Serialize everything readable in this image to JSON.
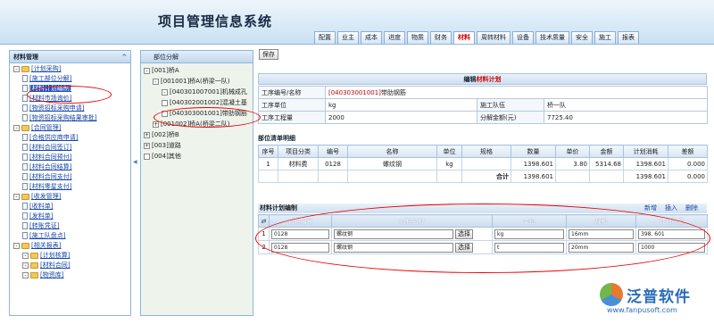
{
  "app": {
    "title": "项目管理信息系统"
  },
  "tabs": [
    "配置",
    "业主",
    "成本",
    "进度",
    "物质",
    "财务",
    "材料",
    "周转材料",
    "设备",
    "技术质量",
    "安全",
    "施工",
    "报表"
  ],
  "active_tab": "材料",
  "left_panel": {
    "title": "材料管理",
    "items": [
      {
        "type": "group",
        "label": "[计划采购]",
        "level": 0
      },
      {
        "type": "leaf",
        "label": "[施工部位分解]",
        "level": 1
      },
      {
        "type": "leaf",
        "label": "[材料计划编制]",
        "level": 1,
        "selected": true
      },
      {
        "type": "leaf",
        "label": "[材料市场询价]",
        "level": 1
      },
      {
        "type": "leaf",
        "label": "[物资招标采购申请]",
        "level": 1
      },
      {
        "type": "leaf",
        "label": "[物资招标采购结果审批]",
        "level": 1
      },
      {
        "type": "group",
        "label": "[合同管理]",
        "level": 0
      },
      {
        "type": "leaf",
        "label": "[合格供应商申请]",
        "level": 1
      },
      {
        "type": "leaf",
        "label": "[材料合同签订]",
        "level": 1
      },
      {
        "type": "leaf",
        "label": "[材料合同预付]",
        "level": 1
      },
      {
        "type": "leaf",
        "label": "[材料合同结算]",
        "level": 1
      },
      {
        "type": "leaf",
        "label": "[材料合同支付]",
        "level": 1
      },
      {
        "type": "leaf",
        "label": "[材料零星支付]",
        "level": 1
      },
      {
        "type": "group",
        "label": "[收发管理]",
        "level": 0
      },
      {
        "type": "leaf",
        "label": "[收料单]",
        "level": 1
      },
      {
        "type": "leaf",
        "label": "[发料单]",
        "level": 1
      },
      {
        "type": "leaf",
        "label": "[转账凭证]",
        "level": 1
      },
      {
        "type": "leaf",
        "label": "[施工队盘点]",
        "level": 1
      },
      {
        "type": "group",
        "label": "[相关报表]",
        "level": 0
      },
      {
        "type": "group",
        "label": "[计划核算]",
        "level": 1
      },
      {
        "type": "group",
        "label": "[材料合同]",
        "level": 1
      },
      {
        "type": "group",
        "label": "[物资库]",
        "level": 1
      }
    ]
  },
  "mid_panel": {
    "title": "部位分解",
    "items": [
      {
        "sign": "-",
        "label": "[001]桥A",
        "level": 0
      },
      {
        "sign": "-",
        "label": "[001001]桥A(桥梁一队)",
        "level": 1
      },
      {
        "sign": "-",
        "label": "[040301007001]机械成孔",
        "level": 2
      },
      {
        "sign": "",
        "label": "[040302001002]混凝土基",
        "level": 2
      },
      {
        "sign": "",
        "label": "[040303001001]带肋钢筋",
        "level": 2
      },
      {
        "sign": "+",
        "label": "[001002]桥A(桥梁二队)",
        "level": 1
      },
      {
        "sign": "+",
        "label": "[002]桥B",
        "level": 0
      },
      {
        "sign": "+",
        "label": "[003]道路",
        "level": 0
      },
      {
        "sign": "",
        "label": "[004]其他",
        "level": 0
      }
    ]
  },
  "toolbar": {
    "save": "保存"
  },
  "form": {
    "title_prefix": "编辑",
    "title_red": "材料计划",
    "process_label": "工序编号/名称",
    "process_code": "[040303001001]",
    "process_name": "带肋钢筋",
    "unit_label": "工序单位",
    "unit_value": "kg",
    "team_label": "施工队伍",
    "team_value": "桥一队",
    "qty_label": "工序工程量",
    "qty_value": "2000",
    "total_label": "分解金额(元)",
    "total_value": "7725.40"
  },
  "detail": {
    "title": "部位清单明细",
    "headers": [
      "序号",
      "项目分类",
      "编号",
      "名称",
      "单位",
      "规格",
      "数量",
      "单价",
      "金额",
      "计划消耗",
      "差额"
    ],
    "rows": [
      [
        "1",
        "材料费",
        "0128",
        "螺纹钢",
        "kg",
        "",
        "1398.601",
        "3.80",
        "5314.68",
        "1398.601",
        "0.000"
      ]
    ],
    "total_label": "合计",
    "total_qty": "1398.601",
    "total_plan": "1398.601",
    "total_diff": "0.000"
  },
  "plan": {
    "title": "材料计划编制",
    "links": [
      "新增",
      "插入",
      "删除"
    ],
    "headers": [
      "材料编号",
      "材料名称",
      "单位",
      "规格",
      "计划数量"
    ],
    "pick_label": "选择",
    "rows": [
      {
        "no": "1",
        "code": "0128",
        "name": "螺纹钢",
        "unit": "kg",
        "spec": "16mm",
        "qty": "398. 601"
      },
      {
        "no": "2",
        "code": "0128",
        "name": "螺纹钢",
        "unit": "t",
        "spec": "20mm",
        "qty": "1000"
      }
    ]
  },
  "brand": {
    "name": "泛普软件",
    "url": "www.fanpusoft.com"
  }
}
